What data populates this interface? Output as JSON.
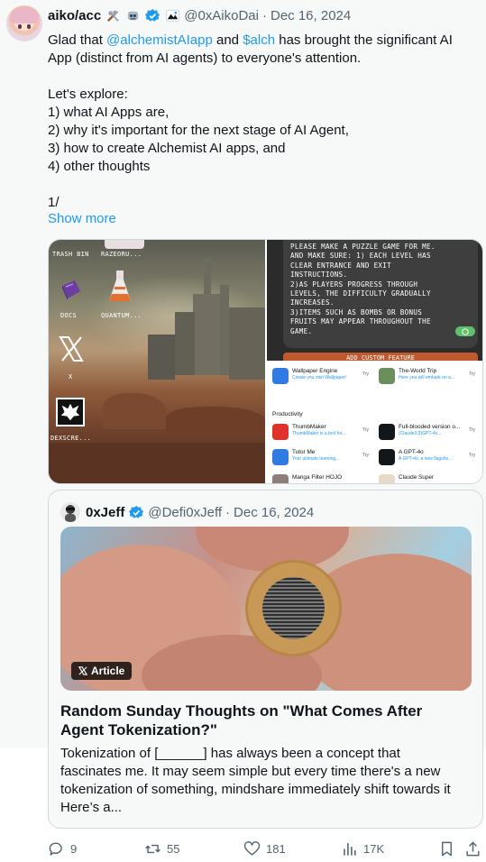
{
  "tweet": {
    "author_name": "aiko/acc",
    "handle": "@0xAikoDai",
    "separator": "·",
    "date": "Dec 16, 2024",
    "text": {
      "l1_pre": "Glad that ",
      "l1_link1": "@alchemistAIapp",
      "l1_mid": " and ",
      "l1_link2": "$alch",
      "l1_post": " has brought the significant AI",
      "l2": "App (distinct from AI agents) to everyone's attention.",
      "l4": "Let's explore:",
      "l5": "1) what AI Apps are,",
      "l6": "2) why it's important for the next stage of AI Agent,",
      "l7": "3) how to create Alchemist AI apps, and",
      "l8": "4) other thoughts",
      "l10": "1/"
    },
    "show_more": "Show more"
  },
  "media": {
    "desktop_labels": {
      "trash": "TRASH BIN",
      "razeoru": "RAZEORU...",
      "docs": "DOCS",
      "quantum": "QUANTUM...",
      "x": "X",
      "dexscreener": "DEXSCRE..."
    },
    "prompt_lines": [
      "PLEASE MAKE A PUZZLE GAME FOR ME.",
      "AND MAKE SURE: 1) EACH LEVEL HAS",
      "CLEAR ENTRANCE AND EXIT",
      "INSTRUCTIONS.",
      "2)AS PLAYERS PROGRESS THROUGH",
      "LEVELS, THE DIFFICULTY GRADUALLY",
      "INCREASES.",
      "3)ITEMS SUCH AS BOMBS OR BONUS",
      "FRUITS MAY APPEAR THROUGHOUT THE",
      "GAME."
    ],
    "add_feature": "ADD CUSTOM FEATURE",
    "apps": {
      "section": "Productivity",
      "try": "Try",
      "items": [
        {
          "name": "Wallpaper Engine",
          "desc": "Create you own Wallpaper!",
          "color": "#2f7be3"
        },
        {
          "name": "The-World Trip",
          "desc": "Here you will embark on a...",
          "color": "#6b8f5a"
        },
        {
          "name": "ThumbMaker",
          "desc": "ThumbMaker is a tool for...",
          "color": "#e0312b"
        },
        {
          "name": "Full-blooded version o...",
          "desc": "(Claude3.5)GPT-4o...",
          "color": "#14171a"
        },
        {
          "name": "Tutor Me",
          "desc": "Your ultimate learning...",
          "color": "#2f7be3"
        },
        {
          "name": "A GPT-4o",
          "desc": "A GPT-4o, a new flagsho...",
          "color": "#14171a"
        },
        {
          "name": "Manga Filter HOJO",
          "desc": "",
          "color": "#8c7f78"
        },
        {
          "name": "Claude Super",
          "desc": "",
          "color": "#e9d9c8"
        }
      ]
    }
  },
  "quote": {
    "author_name": "0xJeff",
    "handle": "@Defi0xJeff",
    "separator": "·",
    "date": "Dec 16, 2024",
    "article_tag": "Article",
    "title_l1": "Random Sunday Thoughts on \"What Comes After",
    "title_l2": "Agent Tokenization?\"",
    "excerpt_l1": "Tokenization of [______] has always been a concept that",
    "excerpt_l2": "fascinates me. It may seem simple but every time there's a new",
    "excerpt_l3": "tokenization of something, mindshare immediately shift towards it",
    "excerpt_l4": "Here’s a..."
  },
  "actions": {
    "replies": "9",
    "reposts": "55",
    "likes": "181",
    "views": "17K"
  },
  "colors": {
    "link": "#1d9bf0",
    "muted": "#536471",
    "verified": "#1d9bf0"
  }
}
